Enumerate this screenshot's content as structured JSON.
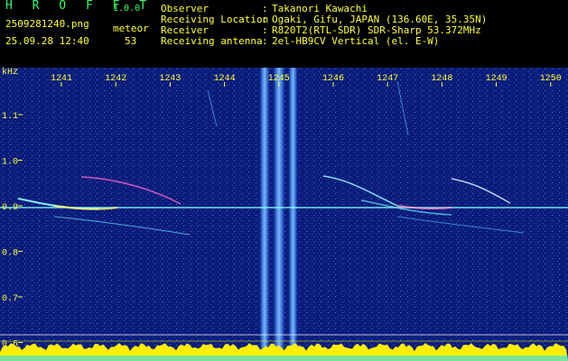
{
  "app": {
    "name": "H R O F F T",
    "version": "1.0.0"
  },
  "file": {
    "name": "2509281240.png",
    "datetime": "25.09.28 12:40"
  },
  "meteor": {
    "label": "meteor",
    "count": "53"
  },
  "info": [
    {
      "label": "Observer",
      "value": "Takanori Kawachi"
    },
    {
      "label": "Receiving Location",
      "value": "Ogaki, Gifu, JAPAN (136.60E, 35.35N)"
    },
    {
      "label": "Receiver",
      "value": "R820T2(RTL-SDR) SDR-Sharp 53.372MHz"
    },
    {
      "label": "Receiving antenna",
      "value": "2el-HB9CV Vertical (el. E-W)"
    }
  ],
  "colon": ":",
  "spectrogram": {
    "unit_label": "kHz",
    "time_ticks": [
      "1241",
      "1242",
      "1243",
      "1244",
      "1245",
      "1246",
      "1247",
      "1248",
      "1249",
      "1250"
    ],
    "freq_ticks": [
      "1.1",
      "1.0",
      "0.9",
      "0.8",
      "0.7",
      "0.6"
    ],
    "colors": {
      "background": "#0a1a6e",
      "signal": "#7ff0ff",
      "label": "#ffff33",
      "level": "#ffee00"
    }
  }
}
